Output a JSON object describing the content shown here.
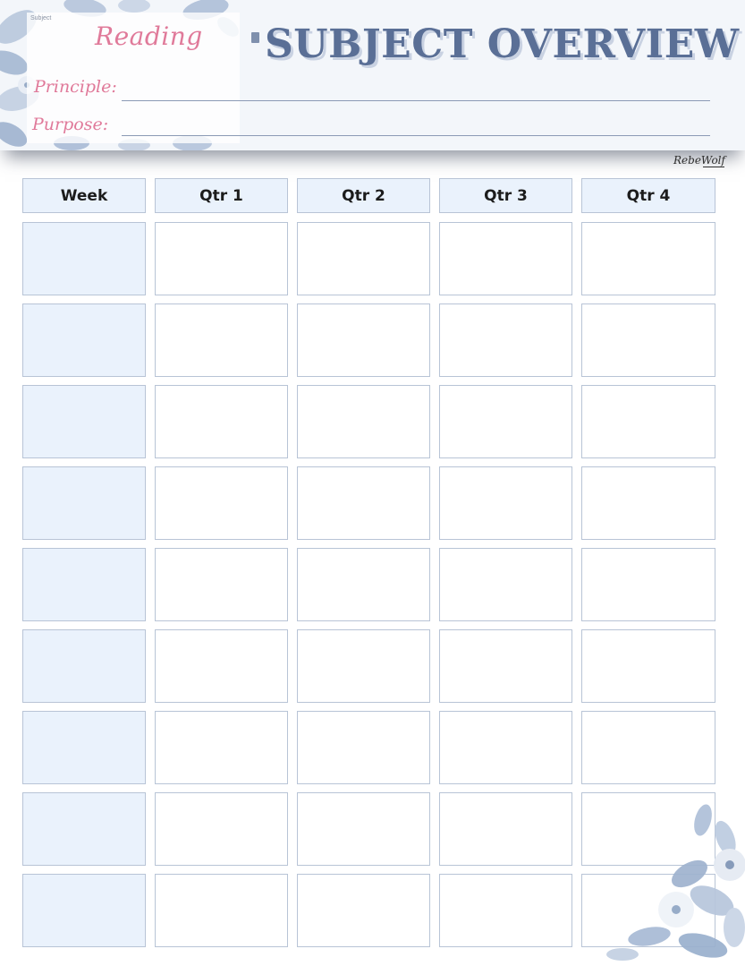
{
  "header": {
    "subject_caption": "Subject",
    "subject_value": "Reading",
    "principle_label": "Principle:",
    "purpose_label": "Purpose:",
    "title": "SUBJECT OVERVIEW",
    "signature": "RebeWolf"
  },
  "table": {
    "columns": [
      "Week",
      "Qtr 1",
      "Qtr 2",
      "Qtr 3",
      "Qtr 4"
    ],
    "row_count": 9
  },
  "colors": {
    "accent_pink": "#e07a9a",
    "title_blue": "#5a6f96",
    "cell_border": "#b8c4d6",
    "week_fill": "#eaf2fc"
  },
  "icons": [
    "floral-decoration-top-left",
    "floral-decoration-bottom-right"
  ]
}
